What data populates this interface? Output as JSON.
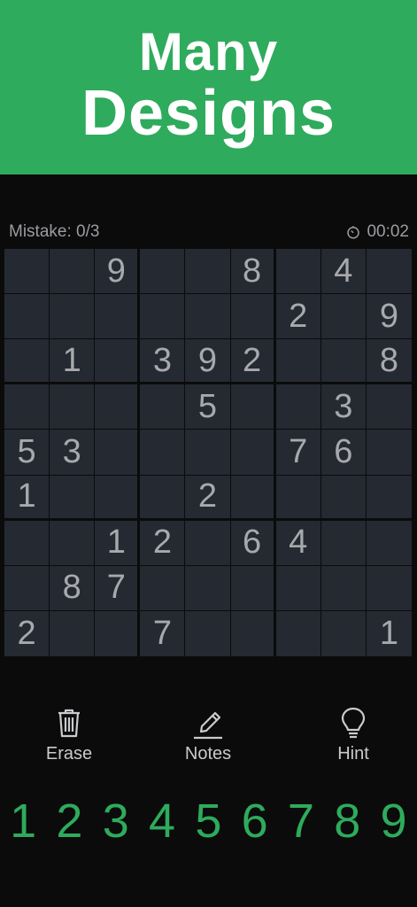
{
  "banner": {
    "line1": "Many",
    "line2": "Designs",
    "bg": "#2eab5c"
  },
  "status": {
    "mistakes": "Mistake: 0/3",
    "timer": "00:02",
    "timer_icon": "stopwatch-icon"
  },
  "board": [
    [
      "",
      "",
      "9",
      "",
      "",
      "8",
      "",
      "4",
      ""
    ],
    [
      "",
      "",
      "",
      "",
      "",
      "",
      "2",
      "",
      "9"
    ],
    [
      "",
      "1",
      "",
      "3",
      "9",
      "2",
      "",
      "",
      "8"
    ],
    [
      "",
      "",
      "",
      "",
      "5",
      "",
      "",
      "3",
      ""
    ],
    [
      "5",
      "3",
      "",
      "",
      "",
      "",
      "7",
      "6",
      ""
    ],
    [
      "1",
      "",
      "",
      "",
      "2",
      "",
      "",
      "",
      ""
    ],
    [
      "",
      "",
      "1",
      "2",
      "",
      "6",
      "4",
      "",
      ""
    ],
    [
      "",
      "8",
      "7",
      "",
      "",
      "",
      "",
      "",
      ""
    ],
    [
      "2",
      "",
      "",
      "7",
      "",
      "",
      "",
      "",
      "1"
    ]
  ],
  "tools": {
    "erase": {
      "label": "Erase",
      "icon": "trash-icon"
    },
    "notes": {
      "label": "Notes",
      "icon": "pencil-icon"
    },
    "hint": {
      "label": "Hint",
      "icon": "lightbulb-icon"
    }
  },
  "numpad": [
    "1",
    "2",
    "3",
    "4",
    "5",
    "6",
    "7",
    "8",
    "9"
  ],
  "colors": {
    "accent": "#2eab5c",
    "cell": "#252932",
    "background": "#0b0b0b"
  }
}
